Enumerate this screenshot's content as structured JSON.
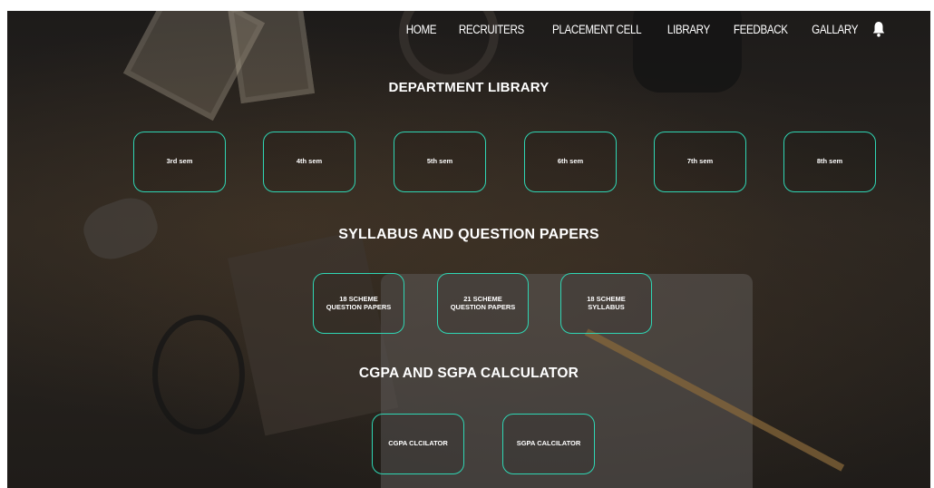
{
  "nav": {
    "links": [
      "HOME",
      "RECRUITERS",
      "PLACEMENT CELL",
      "LIBRARY",
      "FEEDBACK",
      "GALLARY"
    ],
    "notification_icon": "bell-icon"
  },
  "sections": {
    "department_library": {
      "title": "DEPARTMENT LIBRARY",
      "buttons": [
        "3rd sem",
        "4th sem",
        "5th sem",
        "6th sem",
        "7th sem",
        "8th sem"
      ]
    },
    "syllabus": {
      "title": "SYLLABUS AND QUESTION PAPERS",
      "buttons": [
        {
          "line1": "18 SCHEME",
          "line2": "QUESTION PAPERS"
        },
        {
          "line1": "21 SCHEME",
          "line2": "QUESTION PAPERS"
        },
        {
          "line1": "18 SCHEME",
          "line2": "SYLLABUS"
        }
      ]
    },
    "calculator": {
      "title": "CGPA AND SGPA CALCULATOR",
      "buttons": [
        "CGPA CLCILATOR",
        "SGPA CALCILATOR"
      ]
    }
  },
  "colors": {
    "accent": "#2fd6b4",
    "text": "#ffffff",
    "background": "#1f1c19"
  }
}
